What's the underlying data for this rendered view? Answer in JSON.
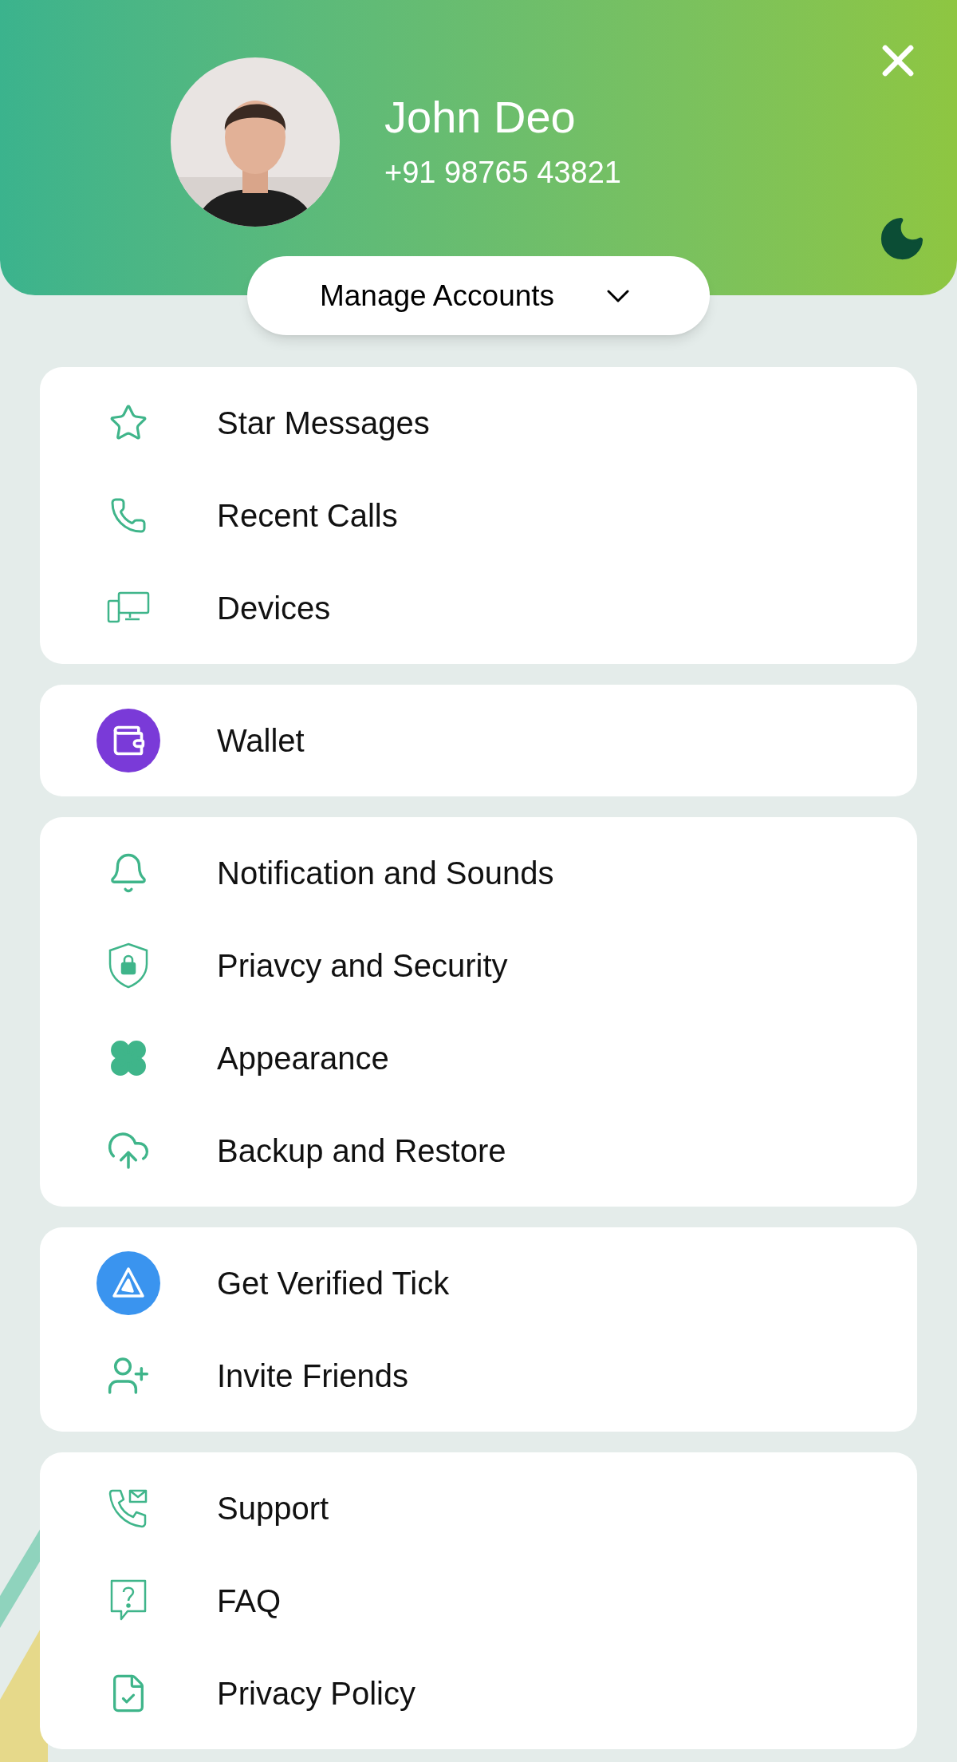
{
  "profile": {
    "name": "John Deo",
    "phone": "+91 98765 43821"
  },
  "manage_accounts": {
    "label": "Manage Accounts"
  },
  "groups": [
    {
      "items": [
        {
          "kind": "star",
          "label": "Star Messages"
        },
        {
          "kind": "phone",
          "label": "Recent Calls"
        },
        {
          "kind": "devices",
          "label": "Devices"
        }
      ]
    },
    {
      "items": [
        {
          "kind": "wallet",
          "label": "Wallet"
        }
      ]
    },
    {
      "items": [
        {
          "kind": "bell",
          "label": "Notification and Sounds"
        },
        {
          "kind": "shield",
          "label": "Priavcy and Security"
        },
        {
          "kind": "flower",
          "label": "Appearance"
        },
        {
          "kind": "cloud",
          "label": "Backup and Restore"
        }
      ]
    },
    {
      "items": [
        {
          "kind": "verified",
          "label": "Get Verified Tick"
        },
        {
          "kind": "invite",
          "label": "Invite Friends"
        }
      ]
    },
    {
      "items": [
        {
          "kind": "support",
          "label": "Support"
        },
        {
          "kind": "faq",
          "label": "FAQ"
        },
        {
          "kind": "policy",
          "label": "Privacy Policy"
        }
      ]
    }
  ]
}
